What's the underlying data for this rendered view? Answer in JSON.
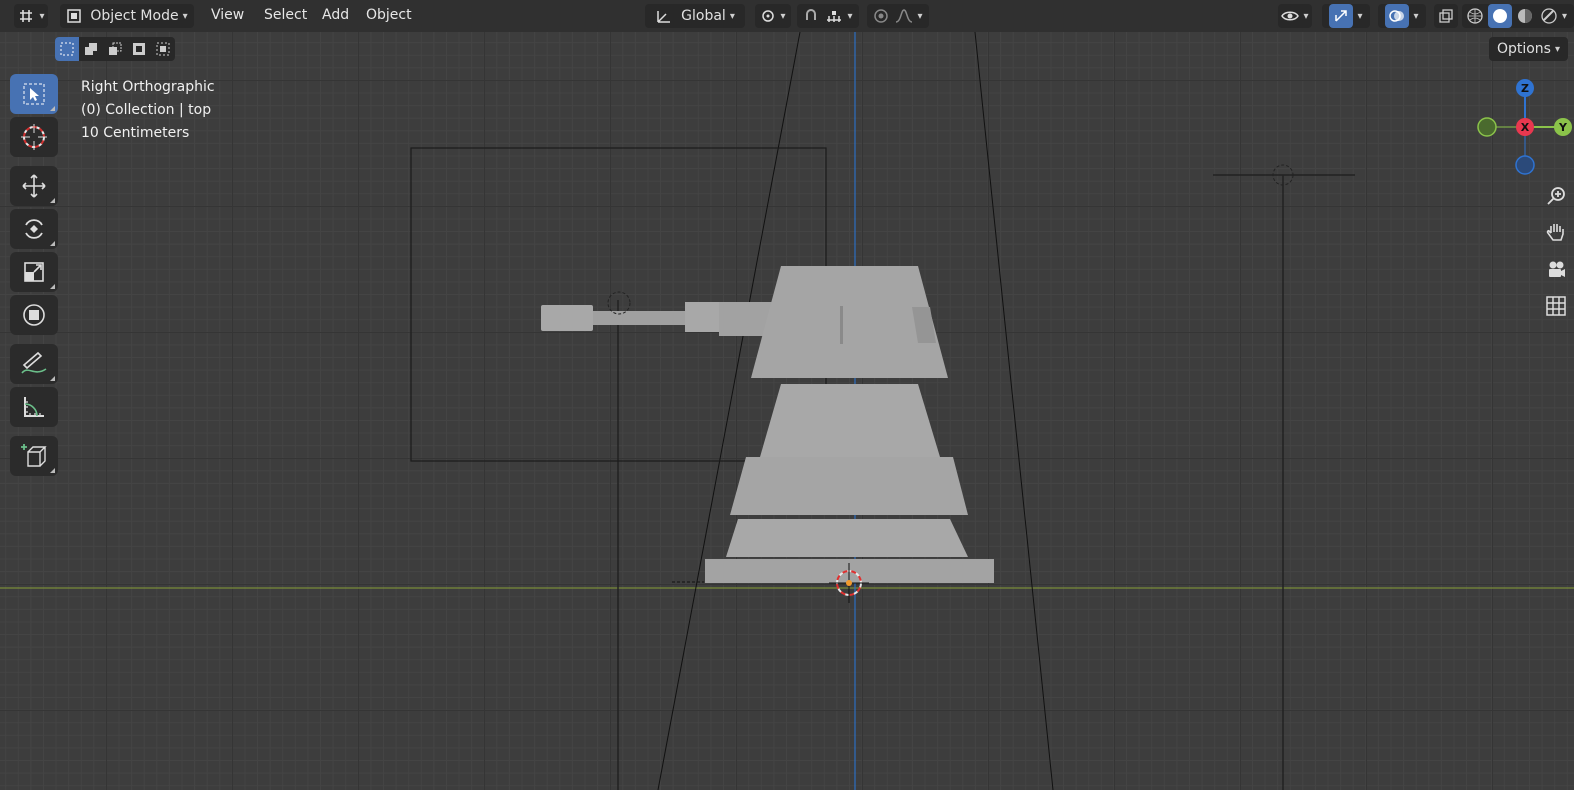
{
  "header": {
    "mode_label": "Object Mode",
    "menus": [
      "View",
      "Select",
      "Add",
      "Object"
    ],
    "transform_orientation": "Global",
    "options_label": "Options"
  },
  "viewport_info": {
    "view_name": "Right Orthographic",
    "collection": "(0) Collection | top",
    "scale": "10 Centimeters"
  },
  "gizmo": {
    "z_label": "Z",
    "x_label": "X",
    "y_label": "Y",
    "colors": {
      "z": "#2f73d1",
      "x": "#e8384f",
      "y": "#8bc34a"
    }
  },
  "toolbar": {
    "tools": [
      "select-box",
      "cursor",
      "move",
      "rotate",
      "scale",
      "transform",
      "annotate",
      "measure",
      "add-cube"
    ],
    "active_tool": "select-box"
  },
  "colors": {
    "accent": "#4772b3",
    "axis_y_line": "#7a8c3a",
    "axis_z_line": "#2c6fc2",
    "model": "#a5a5a5"
  }
}
